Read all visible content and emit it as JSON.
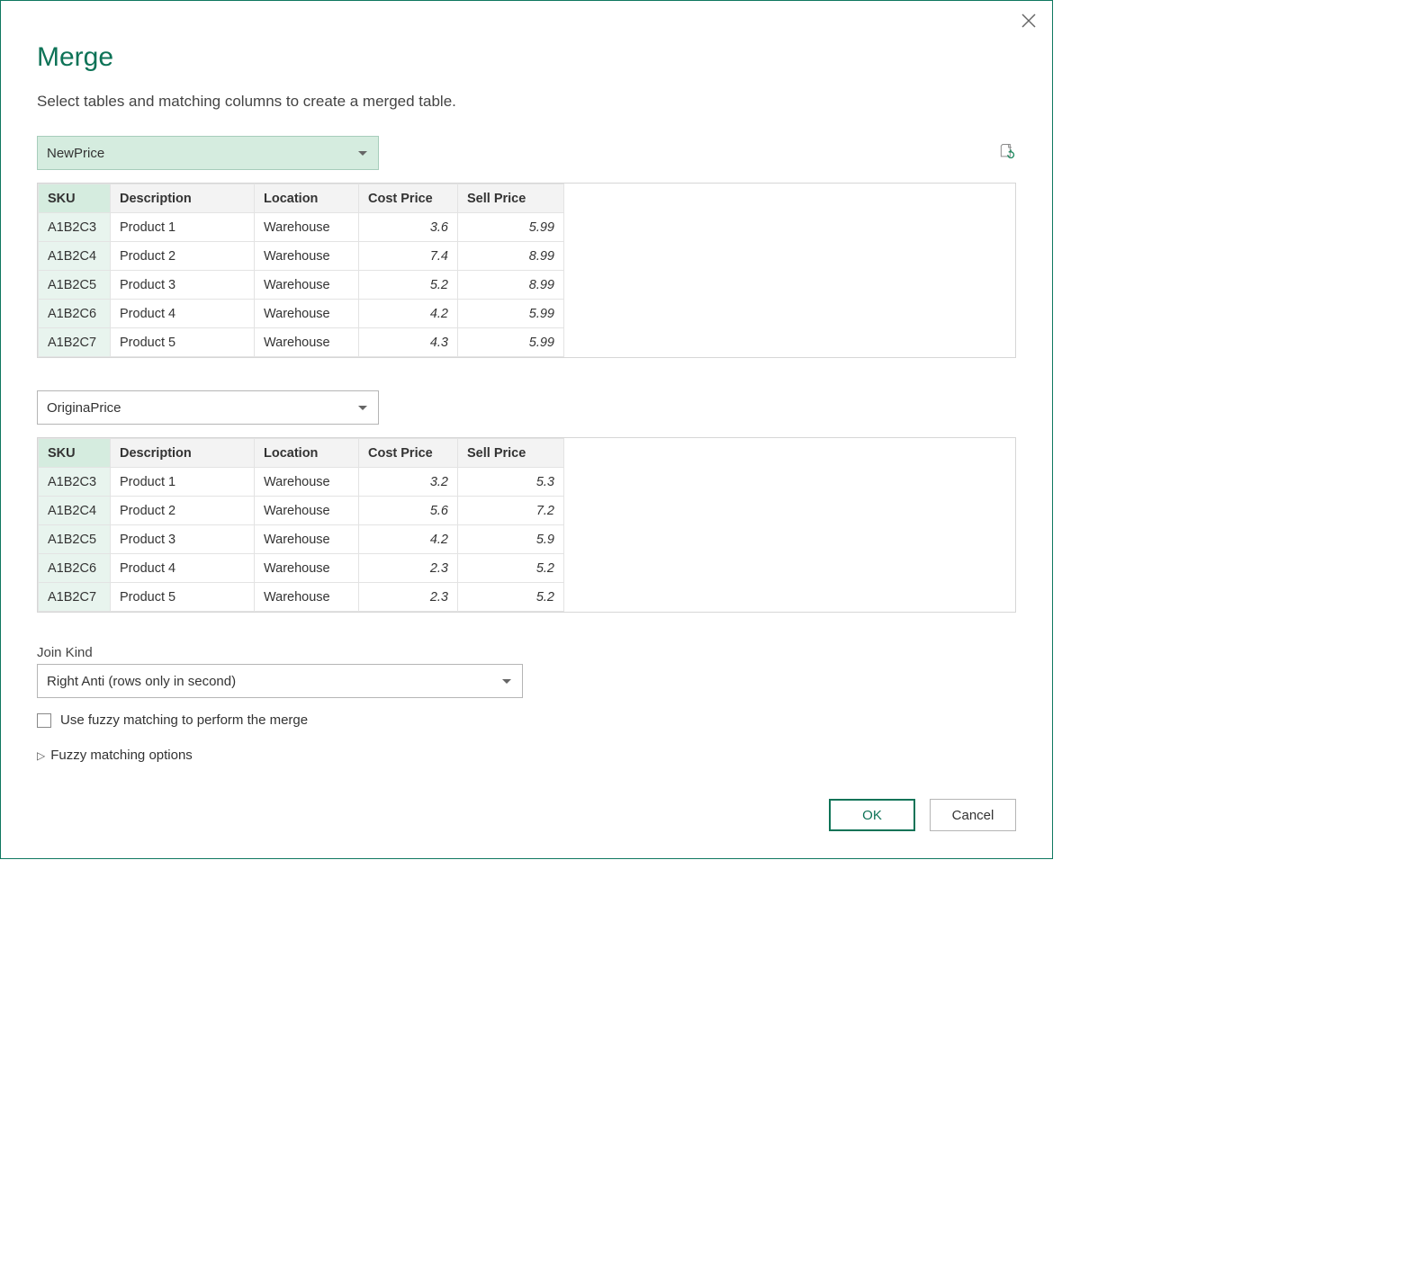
{
  "title": "Merge",
  "subtitle": "Select tables and matching columns to create a merged table.",
  "table1": {
    "source": "NewPrice",
    "columns": [
      "SKU",
      "Description",
      "Location",
      "Cost Price",
      "Sell Price"
    ],
    "rows": [
      {
        "sku": "A1B2C3",
        "desc": "Product 1",
        "loc": "Warehouse",
        "cost": "3.6",
        "sell": "5.99"
      },
      {
        "sku": "A1B2C4",
        "desc": "Product 2",
        "loc": "Warehouse",
        "cost": "7.4",
        "sell": "8.99"
      },
      {
        "sku": "A1B2C5",
        "desc": "Product 3",
        "loc": "Warehouse",
        "cost": "5.2",
        "sell": "8.99"
      },
      {
        "sku": "A1B2C6",
        "desc": "Product 4",
        "loc": "Warehouse",
        "cost": "4.2",
        "sell": "5.99"
      },
      {
        "sku": "A1B2C7",
        "desc": "Product 5",
        "loc": "Warehouse",
        "cost": "4.3",
        "sell": "5.99"
      }
    ]
  },
  "table2": {
    "source": "OriginaPrice",
    "columns": [
      "SKU",
      "Description",
      "Location",
      "Cost Price",
      "Sell Price"
    ],
    "rows": [
      {
        "sku": "A1B2C3",
        "desc": "Product 1",
        "loc": "Warehouse",
        "cost": "3.2",
        "sell": "5.3"
      },
      {
        "sku": "A1B2C4",
        "desc": "Product 2",
        "loc": "Warehouse",
        "cost": "5.6",
        "sell": "7.2"
      },
      {
        "sku": "A1B2C5",
        "desc": "Product 3",
        "loc": "Warehouse",
        "cost": "4.2",
        "sell": "5.9"
      },
      {
        "sku": "A1B2C6",
        "desc": "Product 4",
        "loc": "Warehouse",
        "cost": "2.3",
        "sell": "5.2"
      },
      {
        "sku": "A1B2C7",
        "desc": "Product 5",
        "loc": "Warehouse",
        "cost": "2.3",
        "sell": "5.2"
      }
    ]
  },
  "join": {
    "label": "Join Kind",
    "value": "Right Anti (rows only in second)"
  },
  "fuzzy_checkbox": "Use fuzzy matching to perform the merge",
  "fuzzy_expander": "Fuzzy matching options",
  "buttons": {
    "ok": "OK",
    "cancel": "Cancel"
  }
}
